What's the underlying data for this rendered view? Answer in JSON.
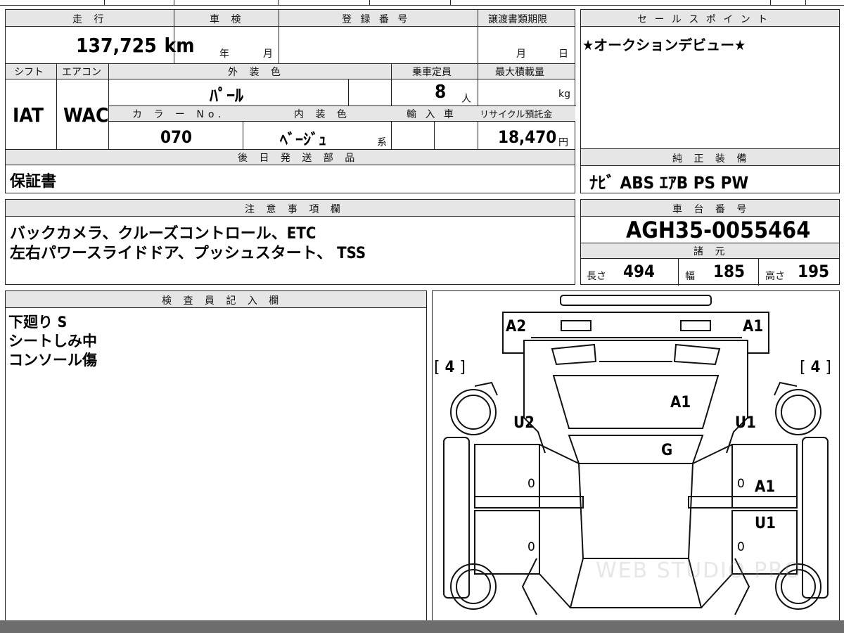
{
  "top_info": {
    "mileage_header": "走 行",
    "mileage_value": "137,725",
    "mileage_unit": "km",
    "shaken_header": "車 検",
    "shaken_year": "年",
    "shaken_month": "月",
    "registration_header": "登 録 番 号",
    "transfer_header": "譲渡書類期限",
    "transfer_month": "月",
    "transfer_day": "日"
  },
  "sales_points": {
    "header": "セ ー ル ス ポ イ ン ト",
    "text": "★オークションデビュー★"
  },
  "spec_grid": {
    "shift_header": "シフト",
    "shift_value": "IAT",
    "ac_header": "エアコン",
    "ac_value": "WAC",
    "ext_color_header": "外 装 色",
    "ext_color_value": "ﾊﾟｰﾙ",
    "capacity_header": "乗車定員",
    "capacity_value": "8",
    "capacity_unit": "人",
    "max_load_header": "最大積載量",
    "max_load_unit": "kg",
    "color_no_header": "カ ラ ー No.",
    "color_no_value": "070",
    "int_color_header": "内 装 色",
    "int_color_value": "ﾍﾞｰｼﾞｭ",
    "int_color_suffix": "系",
    "import_header": "輸 入 車",
    "recycle_header": "リサイクル預託金",
    "recycle_value": "18,470",
    "recycle_unit": "円"
  },
  "later_parts": {
    "header": "後 日 発 送 部 品",
    "value": "保証書"
  },
  "equipment": {
    "header": "純 正 装 備",
    "value": "ﾅﾋﾞ ABS ｴｱB PS PW"
  },
  "notes": {
    "header": "注 意 事 項 欄",
    "line1": "バックカメラ、クルーズコントロール、ETC",
    "line2": "左右パワースライドドア、プッシュスタート、 TSS"
  },
  "chassis": {
    "header": "車 台 番 号",
    "value": "AGH35-0055464",
    "spec_header": "諸 元",
    "length_label": "長さ",
    "length_value": "494",
    "width_label": "幅",
    "width_value": "185",
    "height_label": "高さ",
    "height_value": "195"
  },
  "inspector": {
    "header": "検 査 員 記 入 欄",
    "lines": [
      "下廻り S",
      "シートしみ中",
      "コンソール傷"
    ]
  },
  "diagram": {
    "marks": {
      "rear_left": "A2",
      "rear_right": "A1",
      "tire_left": "4",
      "tire_right": "4",
      "roof": "A1",
      "windshield": "G",
      "left_quarter": "U2",
      "right_quarter": "U1",
      "right_rear_door": "A1",
      "right_front_door": "U1",
      "door_zero": "0"
    },
    "watermark": "WEB STUDIO PRO"
  }
}
